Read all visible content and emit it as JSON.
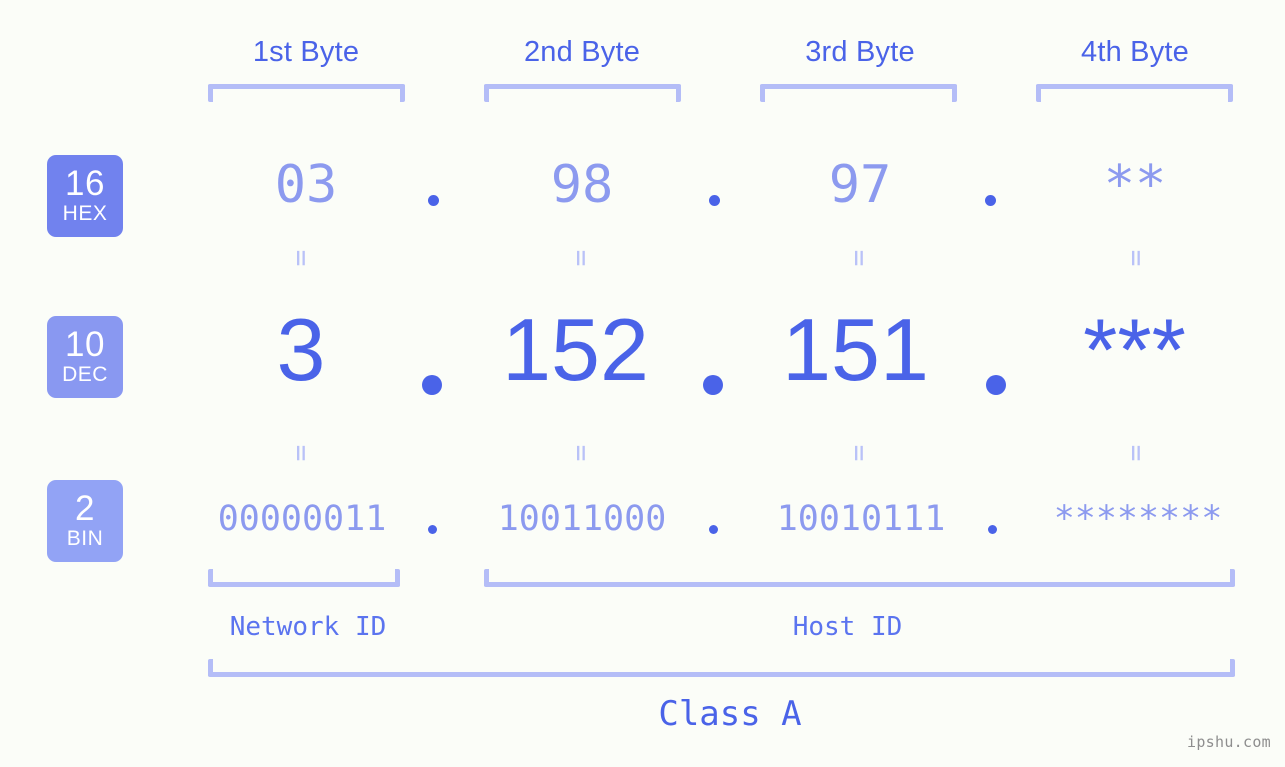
{
  "page": {
    "background": "#fbfdf8",
    "accent": "#4a63e8",
    "accent_light": "#8c9aef",
    "bracket_color": "#b4bdf7",
    "watermark": "ipshu.com"
  },
  "columns": [
    {
      "label": "1st Byte"
    },
    {
      "label": "2nd Byte"
    },
    {
      "label": "3rd Byte"
    },
    {
      "label": "4th Byte"
    }
  ],
  "bases": [
    {
      "number": "16",
      "name": "HEX",
      "color": "#7182ee"
    },
    {
      "number": "10",
      "name": "DEC",
      "color": "#8998f1"
    },
    {
      "number": "2",
      "name": "BIN",
      "color": "#92a3f5"
    }
  ],
  "rows": {
    "hex": {
      "base": "16",
      "values": [
        "03",
        "98",
        "97",
        "**"
      ],
      "separator": "."
    },
    "dec": {
      "base": "10",
      "values": [
        "3",
        "152",
        "151",
        "***"
      ],
      "separator": "."
    },
    "bin": {
      "base": "2",
      "values": [
        "00000011",
        "10011000",
        "10010111",
        "********"
      ],
      "separator": "."
    }
  },
  "equals": {
    "glyph": "=",
    "count_per_gap": 4
  },
  "segments": {
    "network_id": "Network ID",
    "host_id": "Host ID",
    "class": "Class A"
  }
}
